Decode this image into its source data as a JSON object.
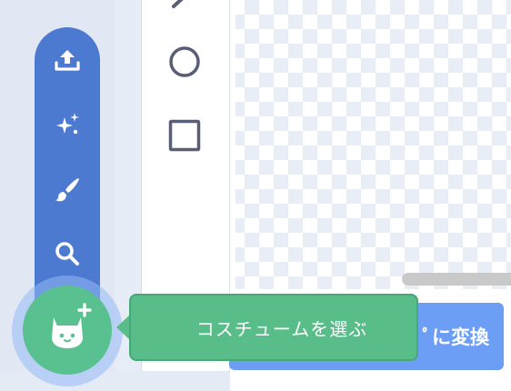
{
  "left_menu": {
    "items": [
      {
        "icon": "upload-icon"
      },
      {
        "icon": "surprise-sparkle-icon"
      },
      {
        "icon": "paint-brush-icon"
      },
      {
        "icon": "search-icon"
      }
    ],
    "main_button_icon": "cat-add-icon"
  },
  "tooltip": {
    "label": "コスチュームを選ぶ"
  },
  "tools": [
    {
      "icon": "line-tool-icon"
    },
    {
      "icon": "circle-tool-icon"
    },
    {
      "icon": "rectangle-tool-icon"
    }
  ],
  "convert_button": {
    "label": "ﾟに変換"
  },
  "colors": {
    "accent_blue": "#4c7ad0",
    "cat_button_green": "#59c08f",
    "tooltip_green": "#59bd8a",
    "convert_blue": "#6d9ef6",
    "icon_gray": "#575e75"
  }
}
